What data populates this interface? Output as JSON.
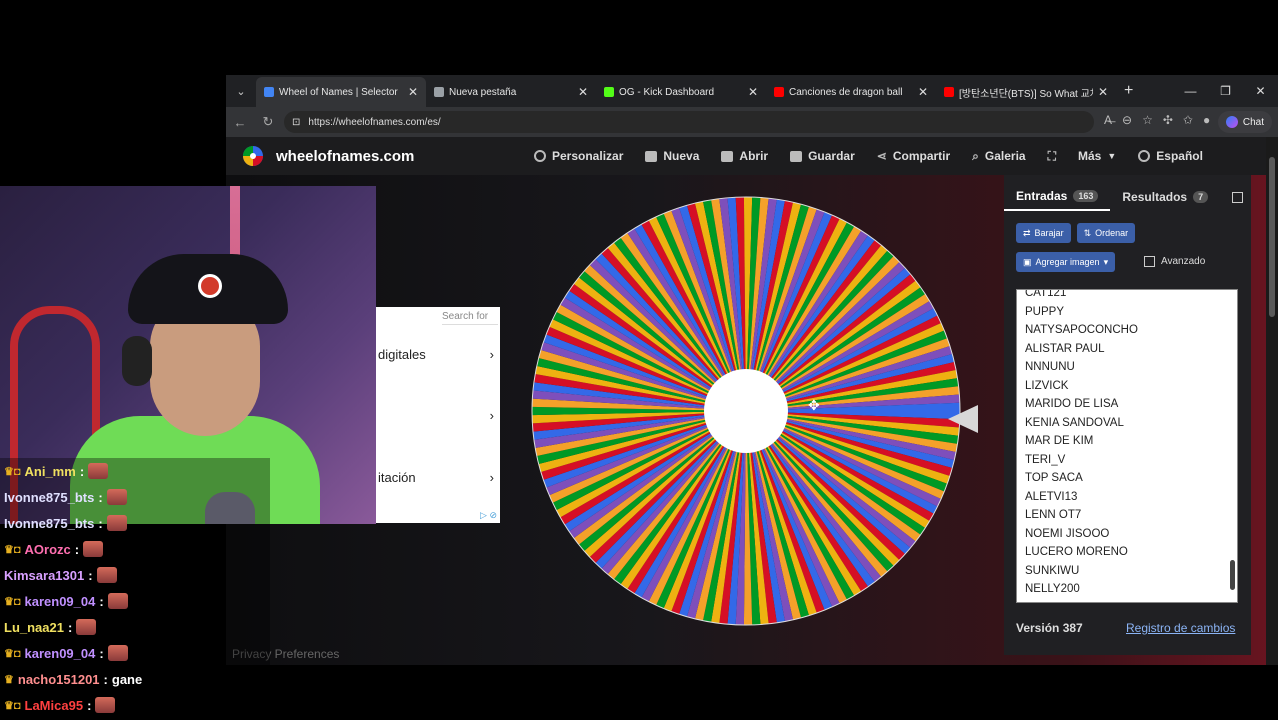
{
  "browser": {
    "tabs": [
      {
        "title": "Wheel of Names | Selector",
        "color": "#4285f4",
        "active": true
      },
      {
        "title": "Nueva pestaña",
        "color": "#9aa0a6",
        "active": false
      },
      {
        "title": "OG - Kick Dashboard",
        "color": "#53fc18",
        "active": false
      },
      {
        "title": "Canciones de dragon ball",
        "color": "#ff0000",
        "active": false
      },
      {
        "title": "[방탄소년단(BTS)] So What 교차",
        "color": "#ff0000",
        "active": false
      }
    ],
    "url": "https://wheelofnames.com/es/",
    "chat_label": "Chat"
  },
  "site": {
    "logo_text": "wheelofnames.com",
    "menu": [
      "Personalizar",
      "Nueva",
      "Abrir",
      "Guardar",
      "Compartir",
      "Galeria",
      "Más",
      "Español"
    ],
    "privacy": "Privacy Preferences"
  },
  "panel": {
    "tab_entries": "Entradas",
    "entries_count": "163",
    "tab_results": "Resultados",
    "results_count": "7",
    "shuffle": "Barajar",
    "sort": "Ordenar",
    "add_image": "Agregar imagen",
    "advanced": "Avanzado",
    "entries_partial_top": "CAT121",
    "entries": [
      "PUPPY",
      "NATYSAPOCONCHO",
      "ALISTAR PAUL",
      "NNNUNU",
      "LIZVICK",
      "MARIDO DE LISA",
      "KENIA SANDOVAL",
      "MAR DE KIM",
      "TERI_V",
      "TOP SACA",
      "ALETVI13",
      "LENN OT7",
      "NOEMI JISOOO",
      "LUCERO MORENO",
      "SUNKIWU",
      "NELLY200"
    ],
    "version": "Versión 387",
    "changelog": "Registro de cambios"
  },
  "wheel": {
    "slices": 163,
    "colors": [
      "#3369e8",
      "#d50f25",
      "#eeb211",
      "#009925",
      "#f4a12a",
      "#7e4fbb"
    ]
  },
  "ad": {
    "search_placeholder": "Search for",
    "rows": [
      "digitales",
      "",
      "itación"
    ]
  },
  "chat": [
    {
      "user": "Ani_mm",
      "color": "#f0e060",
      "badges": "♛◘",
      "text": "",
      "emote": true
    },
    {
      "user": "Ivonne875_bts",
      "color": "#e0e0ff",
      "badges": "",
      "text": "",
      "emote": true
    },
    {
      "user": "Ivonne875_bts",
      "color": "#e0e0ff",
      "badges": "",
      "text": "",
      "emote": true
    },
    {
      "user": "AOrozc",
      "color": "#ff6fb0",
      "badges": "♛◘",
      "text": "",
      "emote": true
    },
    {
      "user": "Kimsara1301",
      "color": "#d8a0ff",
      "badges": "",
      "text": "",
      "emote": true
    },
    {
      "user": "karen09_04",
      "color": "#c090ff",
      "badges": "♛◘",
      "text": "",
      "emote": true
    },
    {
      "user": "Lu_naa21",
      "color": "#f0e060",
      "badges": "",
      "text": "",
      "emote": true
    },
    {
      "user": "karen09_04",
      "color": "#c090ff",
      "badges": "♛◘",
      "text": "",
      "emote": true
    },
    {
      "user": "nacho151201",
      "color": "#ff8f8f",
      "badges": "♛",
      "text": "gane",
      "emote": false
    },
    {
      "user": "LaMica95",
      "color": "#ff4040",
      "badges": "♛◘",
      "text": "",
      "emote": true
    }
  ]
}
